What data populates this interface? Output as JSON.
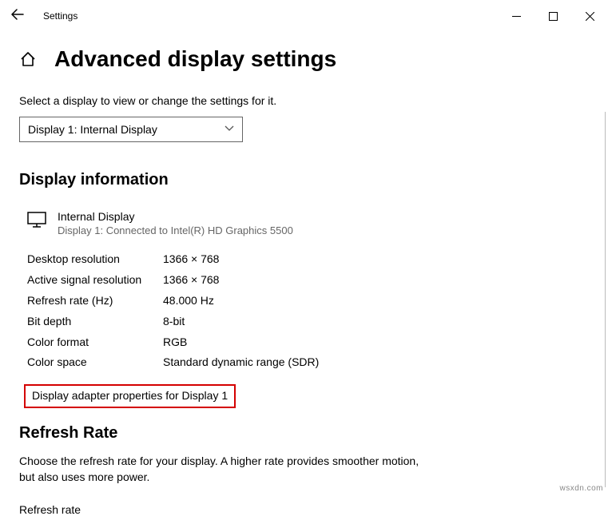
{
  "window": {
    "title": "Settings"
  },
  "page": {
    "title": "Advanced display settings",
    "select_label": "Select a display to view or change the settings for it.",
    "dropdown_selected": "Display 1: Internal Display"
  },
  "display_info": {
    "heading": "Display information",
    "monitor_name": "Internal Display",
    "monitor_desc": "Display 1: Connected to Intel(R) HD Graphics 5500",
    "rows": [
      {
        "label": "Desktop resolution",
        "value": "1366 × 768"
      },
      {
        "label": "Active signal resolution",
        "value": "1366 × 768"
      },
      {
        "label": "Refresh rate (Hz)",
        "value": "48.000 Hz"
      },
      {
        "label": "Bit depth",
        "value": "8-bit"
      },
      {
        "label": "Color format",
        "value": "RGB"
      },
      {
        "label": "Color space",
        "value": "Standard dynamic range (SDR)"
      }
    ],
    "adapter_link": "Display adapter properties for Display 1"
  },
  "refresh_rate": {
    "heading": "Refresh Rate",
    "description": "Choose the refresh rate for your display. A higher rate provides smoother motion, but also uses more power.",
    "label": "Refresh rate"
  },
  "watermark": "wsxdn.com"
}
